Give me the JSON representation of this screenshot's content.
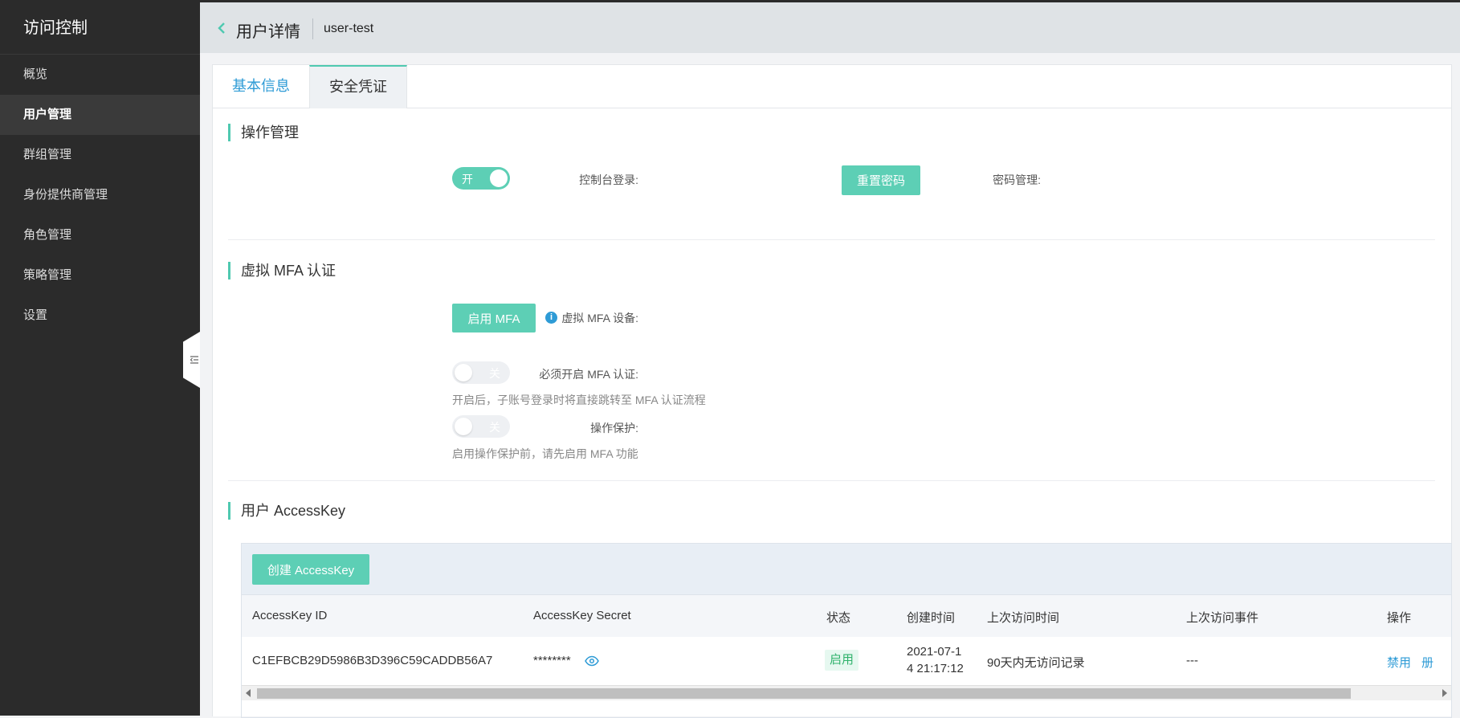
{
  "sidebar": {
    "title": "访问控制",
    "items": [
      {
        "label": "概览",
        "active": false
      },
      {
        "label": "用户管理",
        "active": true
      },
      {
        "label": "群组管理",
        "active": false
      },
      {
        "label": "身份提供商管理",
        "active": false
      },
      {
        "label": "角色管理",
        "active": false
      },
      {
        "label": "策略管理",
        "active": false
      },
      {
        "label": "设置",
        "active": false
      }
    ]
  },
  "header": {
    "title": "用户详情",
    "user": "user-test"
  },
  "tabs": [
    {
      "label": "基本信息",
      "active": false
    },
    {
      "label": "安全凭证",
      "active": true
    }
  ],
  "operation": {
    "title": "操作管理",
    "console_login_label": "控制台登录:",
    "console_login_state": "开",
    "password_label": "密码管理:",
    "reset_password_button": "重置密码"
  },
  "mfa": {
    "title": "虚拟 MFA 认证",
    "device_label": "虚拟 MFA 设备:",
    "enable_button": "启用 MFA",
    "info_icon": "i",
    "required_label": "必须开启 MFA 认证:",
    "required_state": "关",
    "required_hint": "开启后，子账号登录时将直接跳转至 MFA 认证流程",
    "protect_label": "操作保护:",
    "protect_state": "关",
    "protect_hint": "启用操作保护前，请先启用 MFA 功能"
  },
  "accesskey": {
    "title": "用户 AccessKey",
    "create_button": "创建 AccessKey",
    "columns": [
      "AccessKey ID",
      "AccessKey Secret",
      "状态",
      "创建时间",
      "上次访问时间",
      "上次访问事件",
      "操作"
    ],
    "rows": [
      {
        "id": "C1EFBCB29D5986B3D396C59CADDB56A7",
        "secret": "********",
        "status": "启用",
        "created_line1": "2021-07-1",
        "created_line2": "4 21:17:12",
        "last_access": "90天内无访问记录",
        "last_event": "---",
        "action": "禁用",
        "action_clipped": "册"
      }
    ]
  },
  "colors": {
    "accent": "#5dcfb5",
    "link": "#2e9bd6",
    "sidebar": "#2b2b2b"
  }
}
